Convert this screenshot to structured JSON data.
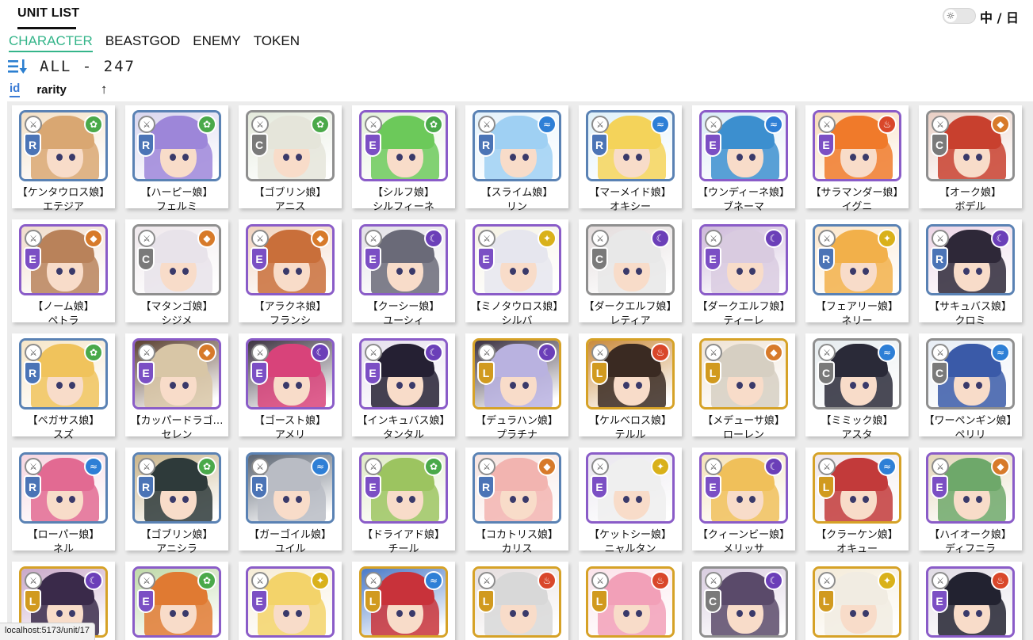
{
  "header": {
    "title": "UNIT LIST",
    "lang_toggle": "中 / 日",
    "theme_icon": "sun-icon"
  },
  "tabs": [
    {
      "label": "CHARACTER",
      "active": true
    },
    {
      "label": "BEASTGOD",
      "active": false
    },
    {
      "label": "ENEMY",
      "active": false
    },
    {
      "label": "TOKEN",
      "active": false
    }
  ],
  "filter": {
    "icon": "sort-filter-icon",
    "text": "ALL - 247"
  },
  "sort": {
    "id_label": "id",
    "rarity_label": "rarity",
    "direction": "↑"
  },
  "colors": {
    "accent_green": "#35b58a",
    "accent_blue": "#3a7bd5"
  },
  "status_url": "localhost:5173/unit/17",
  "units": [
    {
      "race": "【ケンタウロス娘】",
      "name": "エテジア",
      "rarity": "R",
      "element": "wind",
      "hair": "#d9a772",
      "bg": "#f3e0c6"
    },
    {
      "race": "【ハーピー娘】",
      "name": "フェルミ",
      "rarity": "R",
      "element": "wind",
      "hair": "#9d86d9",
      "bg": "#d9d6ee"
    },
    {
      "race": "【ゴブリン娘】",
      "name": "アニス",
      "rarity": "C",
      "element": "wind",
      "hair": "#e5e5da",
      "bg": "#e4eadc"
    },
    {
      "race": "【シルフ娘】",
      "name": "シルフィーネ",
      "rarity": "E",
      "element": "wind",
      "hair": "#6cc95a",
      "bg": "#e3f1da"
    },
    {
      "race": "【スライム娘】",
      "name": "リン",
      "rarity": "R",
      "element": "water",
      "hair": "#9fd0f3",
      "bg": "#e4f2fb"
    },
    {
      "race": "【マーメイド娘】",
      "name": "オキシー",
      "rarity": "R",
      "element": "water",
      "hair": "#f4d35a",
      "bg": "#dff1fa"
    },
    {
      "race": "【ウンディーネ娘】",
      "name": "ブネーマ",
      "rarity": "E",
      "element": "water",
      "hair": "#3c8fcf",
      "bg": "#d9ebf6"
    },
    {
      "race": "【サラマンダー娘】",
      "name": "イグニ",
      "rarity": "E",
      "element": "fire",
      "hair": "#f07a2a",
      "bg": "#f8d9b4"
    },
    {
      "race": "【オーク娘】",
      "name": "ボデル",
      "rarity": "C",
      "element": "earth",
      "hair": "#c8402e",
      "bg": "#e9cfc4"
    },
    {
      "race": "【ノーム娘】",
      "name": "ペトラ",
      "rarity": "E",
      "element": "earth",
      "hair": "#b9825a",
      "bg": "#f0dccb"
    },
    {
      "race": "【マタンゴ娘】",
      "name": "シジメ",
      "rarity": "C",
      "element": "earth",
      "hair": "#e8e3ea",
      "bg": "#efe8ec"
    },
    {
      "race": "【アラクネ娘】",
      "name": "フランシ",
      "rarity": "E",
      "element": "earth",
      "hair": "#c96f3a",
      "bg": "#f0d2bd"
    },
    {
      "race": "【クーシー娘】",
      "name": "ユーシィ",
      "rarity": "E",
      "element": "dark",
      "hair": "#6a6a78",
      "bg": "#e2e0e6"
    },
    {
      "race": "【ミノタウロス娘】",
      "name": "シルバ",
      "rarity": "E",
      "element": "light",
      "hair": "#e6e6ee",
      "bg": "#f5f2e4"
    },
    {
      "race": "【ダークエルフ娘】",
      "name": "レティア",
      "rarity": "C",
      "element": "dark",
      "hair": "#e8e8e8",
      "bg": "#e3dcdc"
    },
    {
      "race": "【ダークエルフ娘】",
      "name": "ティーレ",
      "rarity": "E",
      "element": "dark",
      "hair": "#d9cbe0",
      "bg": "#cdb8d9"
    },
    {
      "race": "【フェアリー娘】",
      "name": "ネリー",
      "rarity": "R",
      "element": "light",
      "hair": "#f2b04a",
      "bg": "#fbe6cb"
    },
    {
      "race": "【サキュバス娘】",
      "name": "クロミ",
      "rarity": "R",
      "element": "dark",
      "hair": "#2e2838",
      "bg": "#ecd5e6"
    },
    {
      "race": "【ペガサス娘】",
      "name": "スズ",
      "rarity": "R",
      "element": "wind",
      "hair": "#f0c35c",
      "bg": "#f6e6c8"
    },
    {
      "race": "【カッパードラゴ…",
      "name": "セレン",
      "rarity": "E",
      "element": "earth",
      "hair": "#d8c6a6",
      "bg": "#5a4030"
    },
    {
      "race": "【ゴースト娘】",
      "name": "アメリ",
      "rarity": "E",
      "element": "dark",
      "hair": "#d8437a",
      "bg": "#3c3340"
    },
    {
      "race": "【インキュバス娘】",
      "name": "タンタル",
      "rarity": "E",
      "element": "dark",
      "hair": "#252033",
      "bg": "#e6e0ee"
    },
    {
      "race": "【デュラハン娘】",
      "name": "プラチナ",
      "rarity": "L",
      "element": "dark",
      "hair": "#b9b2e0",
      "bg": "#3a3040"
    },
    {
      "race": "【ケルベロス娘】",
      "name": "テルル",
      "rarity": "L",
      "element": "fire",
      "hair": "#3a2a22",
      "bg": "#c98a3c"
    },
    {
      "race": "【メデューサ娘】",
      "name": "ローレン",
      "rarity": "L",
      "element": "earth",
      "hair": "#d6cfc2",
      "bg": "#efe3d4"
    },
    {
      "race": "【ミミック娘】",
      "name": "アスタ",
      "rarity": "C",
      "element": "water",
      "hair": "#2a2a38",
      "bg": "#e6ecef"
    },
    {
      "race": "【ワーペンギン娘】",
      "name": "ペリリ",
      "rarity": "C",
      "element": "water",
      "hair": "#3a5aa8",
      "bg": "#e8eef6"
    },
    {
      "race": "【ローパー娘】",
      "name": "ネル",
      "rarity": "R",
      "element": "water",
      "hair": "#e26a92",
      "bg": "#f6d6e0"
    },
    {
      "race": "【ゴブリン娘】",
      "name": "アニシラ",
      "rarity": "R",
      "element": "wind",
      "hair": "#2e3a3a",
      "bg": "#c9b48a"
    },
    {
      "race": "【ガーゴイル娘】",
      "name": "ユイル",
      "rarity": "R",
      "element": "water",
      "hair": "#b9bcc4",
      "bg": "#5a6370"
    },
    {
      "race": "【ドライアド娘】",
      "name": "チール",
      "rarity": "E",
      "element": "wind",
      "hair": "#9cc460",
      "bg": "#dfeac6"
    },
    {
      "race": "【コカトリス娘】",
      "name": "カリス",
      "rarity": "R",
      "element": "earth",
      "hair": "#f2b4b0",
      "bg": "#f6e2de"
    },
    {
      "race": "【ケットシー娘】",
      "name": "ニャルタン",
      "rarity": "E",
      "element": "light",
      "hair": "#efefef",
      "bg": "#e9e6ee"
    },
    {
      "race": "【クィーンビー娘】",
      "name": "メリッサ",
      "rarity": "E",
      "element": "dark",
      "hair": "#f0c05a",
      "bg": "#f4e2b8"
    },
    {
      "race": "【クラーケン娘】",
      "name": "オキュー",
      "rarity": "L",
      "element": "water",
      "hair": "#c23a3a",
      "bg": "#efe6ea"
    },
    {
      "race": "【ハイオーク娘】",
      "name": "ディフニラ",
      "rarity": "E",
      "element": "earth",
      "hair": "#6ea86a",
      "bg": "#e4d6b8"
    },
    {
      "race": "",
      "name": "",
      "rarity": "L",
      "element": "dark",
      "hair": "#3a2a4a",
      "bg": "#c9a8c8"
    },
    {
      "race": "",
      "name": "",
      "rarity": "E",
      "element": "wind",
      "hair": "#e07a32",
      "bg": "#bfd9a8"
    },
    {
      "race": "",
      "name": "",
      "rarity": "E",
      "element": "light",
      "hair": "#f3d36a",
      "bg": "#f6ecd6"
    },
    {
      "race": "",
      "name": "",
      "rarity": "L",
      "element": "water",
      "hair": "#c8323a",
      "bg": "#4a7ac8"
    },
    {
      "race": "",
      "name": "",
      "rarity": "L",
      "element": "fire",
      "hair": "#d8d8d8",
      "bg": "#e6dede"
    },
    {
      "race": "",
      "name": "",
      "rarity": "L",
      "element": "fire",
      "hair": "#f2a0b8",
      "bg": "#fbe3ea"
    },
    {
      "race": "",
      "name": "",
      "rarity": "C",
      "element": "dark",
      "hair": "#5a4a6a",
      "bg": "#d9cde0"
    },
    {
      "race": "",
      "name": "",
      "rarity": "L",
      "element": "light",
      "hair": "#f1ece2",
      "bg": "#f4ebd8"
    },
    {
      "race": "",
      "name": "",
      "rarity": "E",
      "element": "fire",
      "hair": "#222230",
      "bg": "#e0dbe4"
    }
  ]
}
